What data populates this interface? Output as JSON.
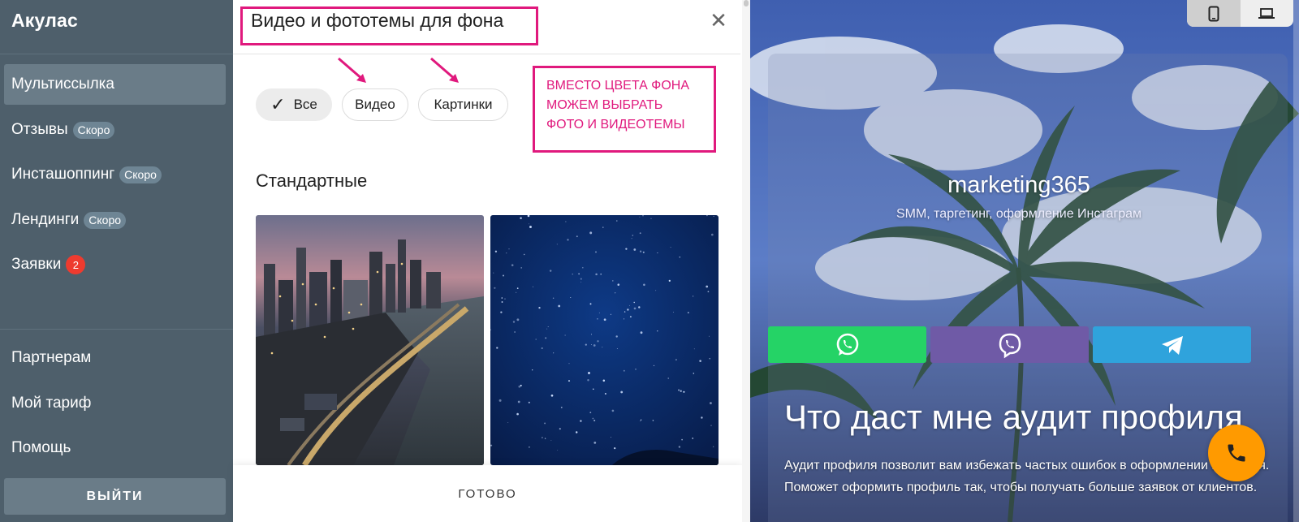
{
  "sidebar": {
    "logo": "Акулас",
    "items": [
      {
        "label": "Мультиссылка",
        "badge": ""
      },
      {
        "label": "Отзывы",
        "badge": "Скоро"
      },
      {
        "label": "Инсташоппинг",
        "badge": "Скоро"
      },
      {
        "label": "Лендинги",
        "badge": "Скоро"
      },
      {
        "label": "Заявки",
        "count": "2"
      }
    ],
    "bottom_items": [
      {
        "label": "Партнерам"
      },
      {
        "label": "Мой тариф"
      },
      {
        "label": "Помощь"
      }
    ],
    "logout_label": "ВЫЙТИ"
  },
  "modal": {
    "title": "Видео и фототемы для фона",
    "close_icon": "close-icon",
    "filters": [
      "Все",
      "Видео",
      "Картинки"
    ],
    "selected_filter": "Все",
    "annotation": "ВМЕСТО ЦВЕТА ФОНА МОЖЕМ ВЫБРАТЬ ФОТО И ВИДЕОТЕМЫ",
    "section_title": "Стандартные",
    "done_label": "ГОТОВО"
  },
  "preview": {
    "profile_name": "marketing365",
    "profile_subtitle": "SMM, таргетинг, оформление Инстаграм",
    "messengers": [
      {
        "name": "whatsapp-icon",
        "color": "#25d366"
      },
      {
        "name": "viber-icon",
        "color": "#6f5aa6"
      },
      {
        "name": "telegram-icon",
        "color": "#2fa3dc"
      }
    ],
    "headline": "Что даст мне аудит профиля",
    "description": "Аудит профиля позволит вам избежать частых ошибок в оформлении профиля. Поможет оформить профиль так, чтобы получать больше заявок от клиентов.",
    "call_color": "#ff9a00"
  },
  "colors": {
    "sidebar_bg": "#4e5f6b",
    "accent_annotation": "#e0197d"
  }
}
